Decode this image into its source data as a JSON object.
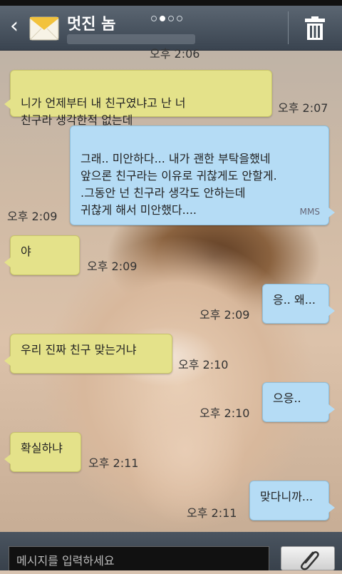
{
  "header": {
    "contact_name": "멋진 놈",
    "page_indicator_active": 2,
    "page_indicator_count": 4
  },
  "messages": [
    {
      "side": "in",
      "text": "니가 언제부터 내 친구였냐고 난 너\n친구라 생각한적 없는데",
      "time": "오후 2:07"
    },
    {
      "side": "out",
      "text": "그래.. 미안하다... 내가 괜한 부탁을했네\n앞으론 친구라는 이유로 귀찮게도 안할게.\n.그동안 넌 친구라 생각도 안하는데\n귀찮게 해서 미안했다....",
      "time": "오후 2:09",
      "badge": "MMS"
    },
    {
      "side": "in",
      "text": "야",
      "time": "오후 2:09"
    },
    {
      "side": "out",
      "text": "응.. 왜...",
      "time": "오후 2:09"
    },
    {
      "side": "in",
      "text": "우리 진짜 친구 맞는거냐",
      "time": "오후 2:10"
    },
    {
      "side": "out",
      "text": "으응..",
      "time": "오후 2:10"
    },
    {
      "side": "in",
      "text": "확실하냐",
      "time": "오후 2:11"
    },
    {
      "side": "out",
      "text": "맞다니까...",
      "time": "오후 2:11"
    }
  ],
  "partial_top_time": "오후 2:06",
  "input": {
    "placeholder": "메시지를 입력하세요"
  },
  "icons": {
    "back": "chevron-left-icon",
    "envelope": "envelope-icon",
    "trash": "trash-icon",
    "attach": "paperclip-icon"
  },
  "colors": {
    "incoming_bubble": "#e4e28a",
    "outgoing_bubble": "#b5dcf5",
    "header": "#46505b"
  }
}
